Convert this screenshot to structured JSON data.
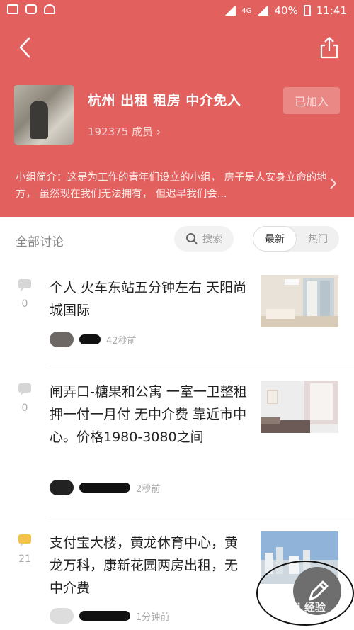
{
  "statusbar": {
    "battery": "40%",
    "time": "11:41",
    "network": "4G"
  },
  "header": {
    "group_title": "杭州 出租 租房 中介免入",
    "members": "192375 成员",
    "joined_label": "已加入",
    "intro": "小组简介：这是为工作的青年们设立的小组， 房子是人安身立命的地方， 虽然现在我们无法拥有， 但迟早我们会..."
  },
  "tabs": {
    "all_label": "全部讨论",
    "search_label": "搜索",
    "newest_label": "最新",
    "hot_label": "热门"
  },
  "posts": [
    {
      "comments": "0",
      "title": "个人 火车东站五分钟左右 天阳尚城国际",
      "time": "42秒前"
    },
    {
      "comments": "0",
      "title": "闸弄口-糖果和公寓 一室一卫整租 押一付一月付 无中介费 靠近市中心。价格1980-3080之间",
      "time": "2秒前"
    },
    {
      "comments": "21",
      "title": "支付宝大楼，黄龙休育中心，黄龙万科，康新花园两房出租，无中介费",
      "time": "1分钟前"
    }
  ],
  "watermark": "Bai 经验",
  "colors": {
    "accent": "#e2605e",
    "comment_highlight": "#f3c24a"
  }
}
